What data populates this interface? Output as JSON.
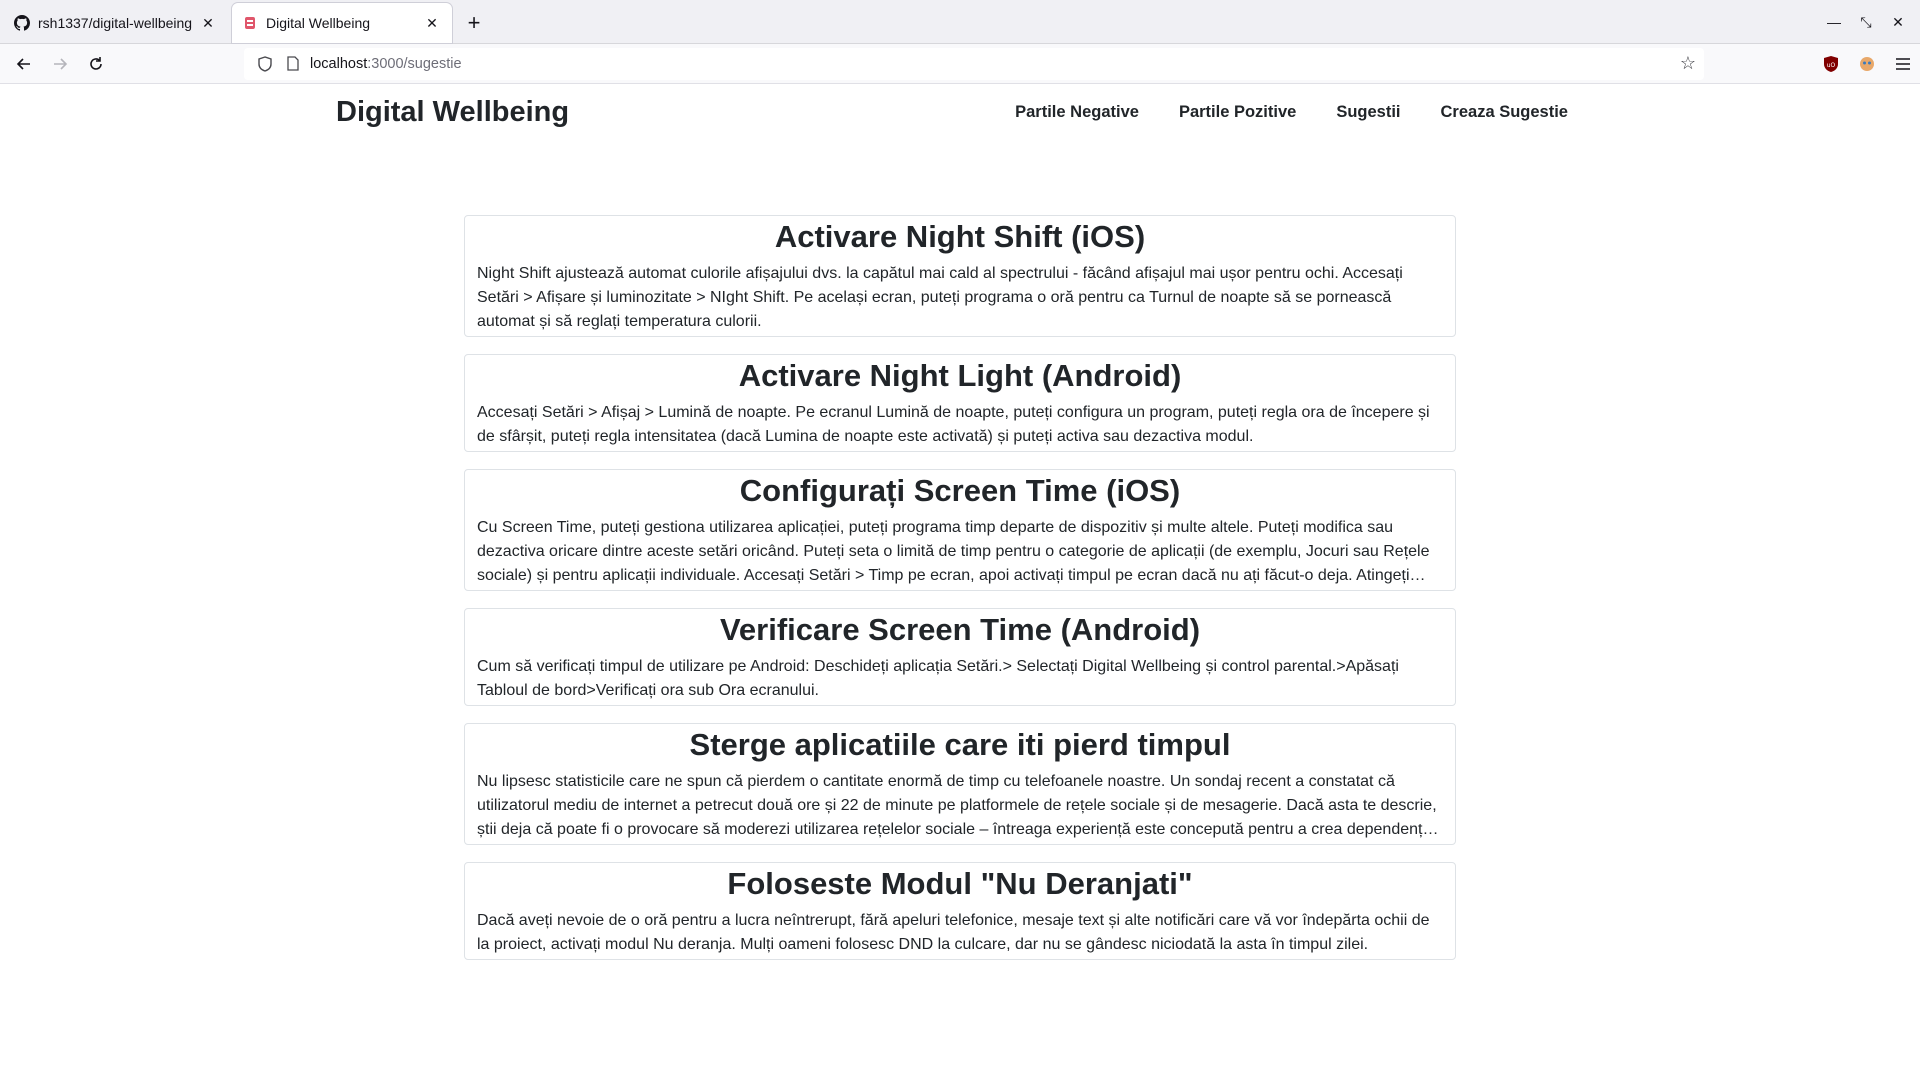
{
  "browser": {
    "tabs": [
      {
        "title": "rsh1337/digital-wellbeing",
        "active": false,
        "favicon": "github-icon"
      },
      {
        "title": "Digital Wellbeing",
        "active": true,
        "favicon": "react-icon"
      }
    ],
    "url": {
      "host": "localhost",
      "path": ":3000/sugestie"
    }
  },
  "site": {
    "brand": "Digital Wellbeing",
    "nav": [
      "Partile Negative",
      "Partile Pozitive",
      "Sugestii",
      "Creaza Sugestie"
    ]
  },
  "suggestions": [
    {
      "title": "Activare Night Shift (iOS)",
      "body": "Night Shift ajustează automat culorile afișajului dvs. la capătul mai cald al spectrului - făcând afișajul mai ușor pentru ochi. Accesați Setări > Afișare și luminozitate > NIght Shift. Pe același ecran, puteți programa o oră pentru ca Turnul de noapte să se pornească automat și să reglați temperatura culorii."
    },
    {
      "title": "Activare Night Light (Android)",
      "body": "Accesați Setări > Afișaj > Lumină de noapte. Pe ecranul Lumină de noapte, puteți configura un program, puteți regla ora de începere și de sfârșit, puteți regla intensitatea (dacă Lumina de noapte este activată) și puteți activa sau dezactiva modul."
    },
    {
      "title": "Configurați Screen Time (iOS)",
      "body": "Cu Screen Time, puteți gestiona utilizarea aplicației, puteți programa timp departe de dispozitiv și multe altele. Puteți modifica sau dezactiva oricare dintre aceste setări oricând. Puteți seta o limită de timp pentru o categorie de aplicații (de exemplu, Jocuri sau Rețele sociale) și pentru aplicații individuale. Accesați Setări > Timp pe ecran, apoi activați timpul pe ecran dacă nu ați făcut-o deja. Atingeți…"
    },
    {
      "title": "Verificare Screen Time (Android)",
      "body": "Cum să verificați timpul de utilizare pe Android: Deschideți aplicația Setări.> Selectați Digital Wellbeing și control parental.>Apăsați Tabloul de bord>Verificați ora sub Ora ecranului."
    },
    {
      "title": "Sterge aplicatiile care iti pierd timpul",
      "body": "Nu lipsesc statisticile care ne spun că pierdem o cantitate enormă de timp cu telefoanele noastre. Un sondaj recent a constatat că utilizatorul mediu de internet a petrecut două ore și 22 de minute pe platformele de rețele sociale și de mesagerie. Dacă asta te descrie, știi deja că poate fi o provocare să moderezi utilizarea rețelelor sociale – întreaga experiență este concepută pentru a crea dependenț…"
    },
    {
      "title": "Foloseste Modul \"Nu Deranjati\"",
      "body": "Dacă aveți nevoie de o oră pentru a lucra neîntrerupt, fără apeluri telefonice, mesaje text și alte notificări care vă vor îndepărta ochii de la proiect, activați modul Nu deranja. Mulți oameni folosesc DND la culcare, dar nu se gândesc niciodată la asta în timpul zilei."
    }
  ]
}
